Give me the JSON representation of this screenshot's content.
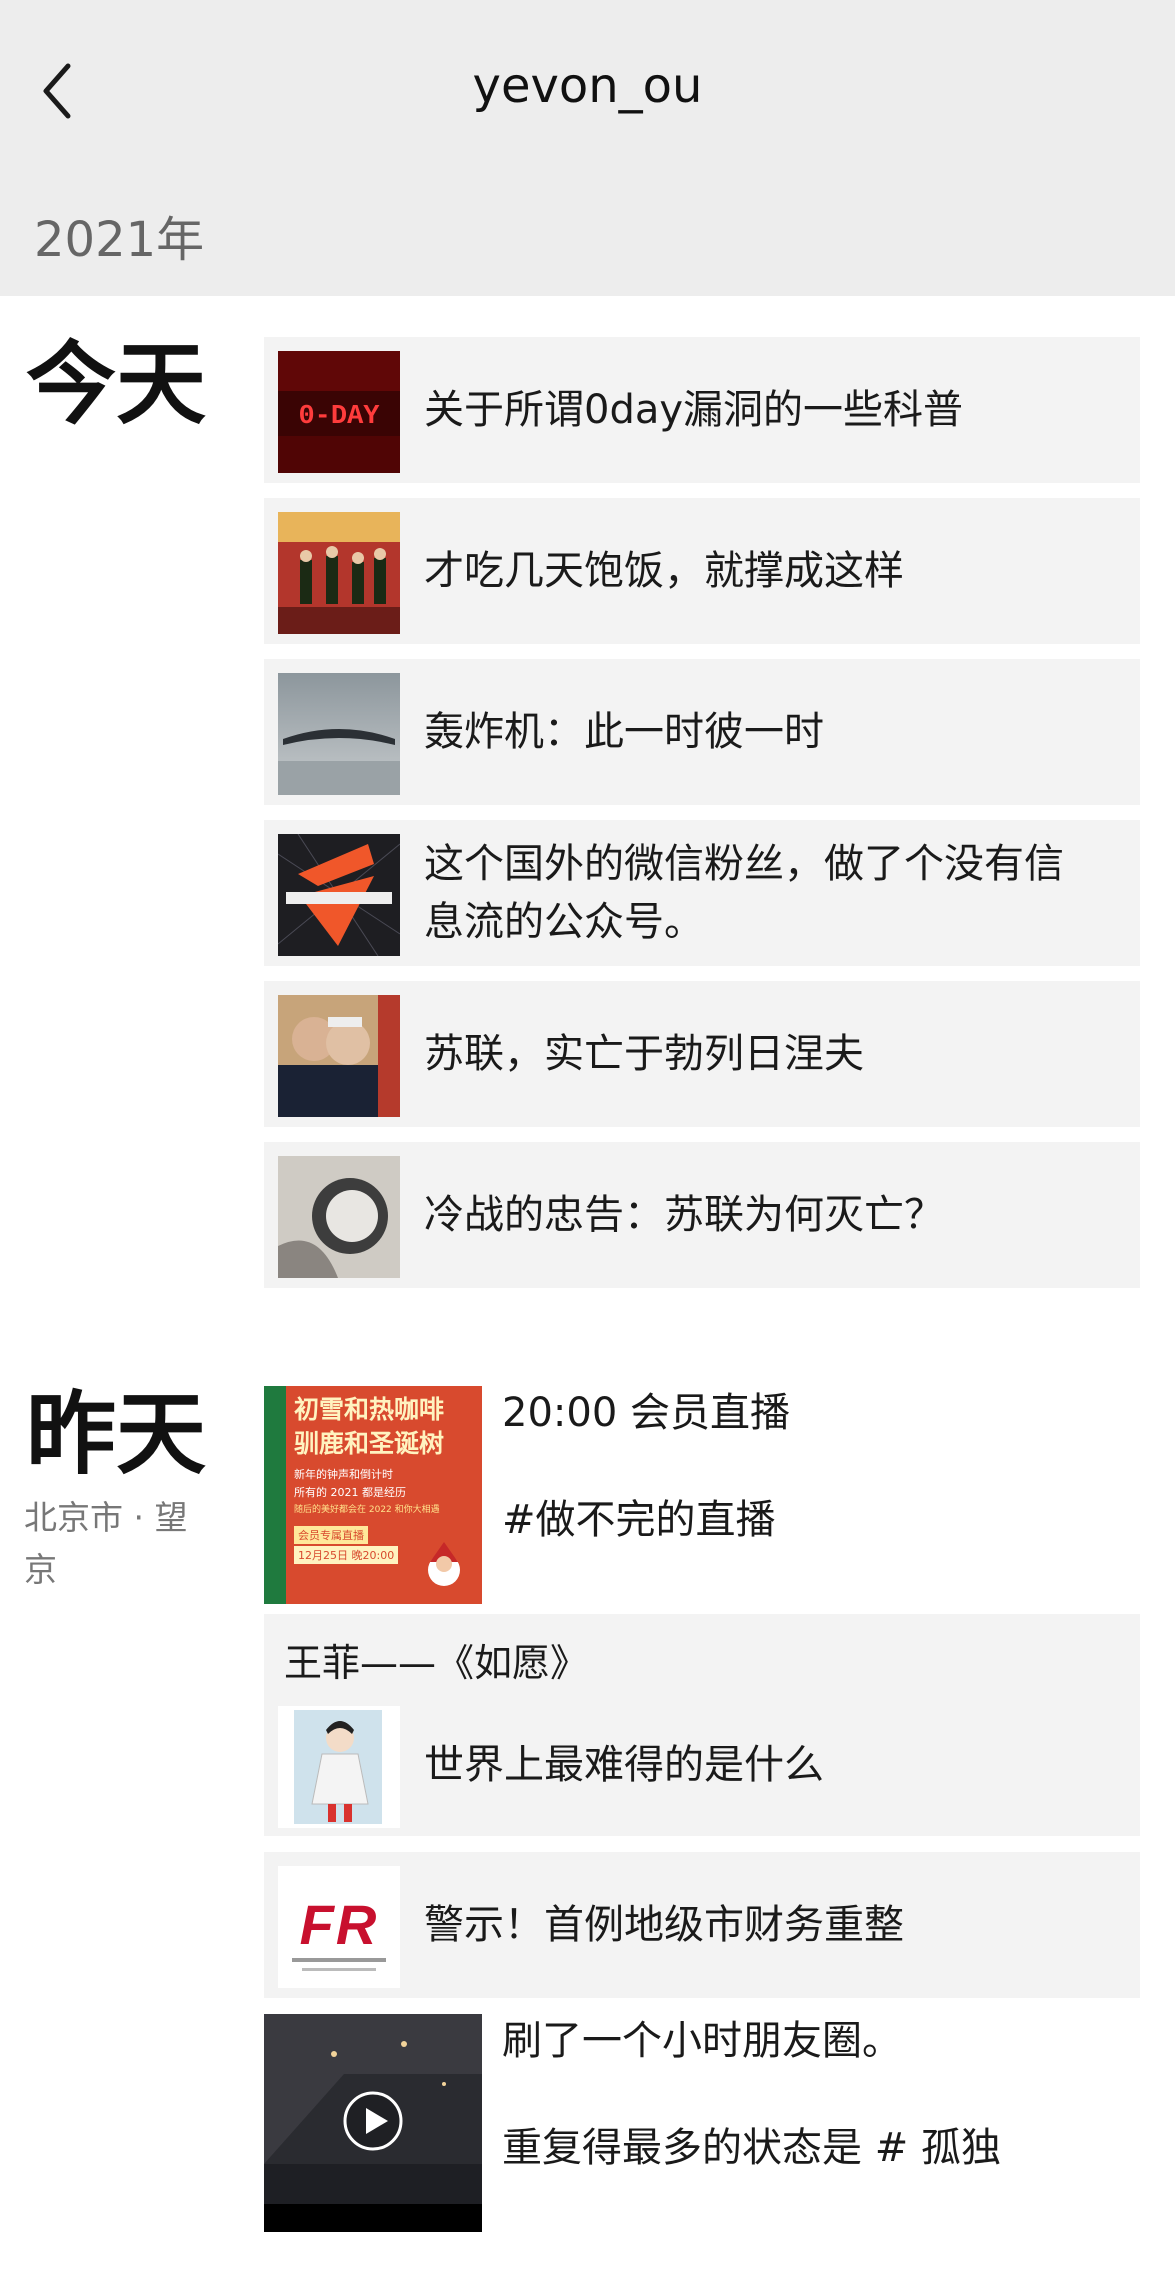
{
  "header": {
    "title": "yevon_ou",
    "year": "2021年"
  },
  "sections": [
    {
      "day": "今天",
      "items": [
        {
          "title": "关于所谓0day漏洞的一些科普",
          "thumb_text": "0-DAY"
        },
        {
          "title": "才吃几天饱饭，就撑成这样"
        },
        {
          "title": "轰炸机：此一时彼一时"
        },
        {
          "title": "这个国外的微信粉丝，做了个没有信息流的公众号。"
        },
        {
          "title": "苏联，实亡于勃列日涅夫"
        },
        {
          "title": "冷战的忠告：苏联为何灭亡？"
        }
      ]
    },
    {
      "day": "昨天",
      "location": "北京市 · 望京",
      "posts": [
        {
          "line1": "20:00 会员直播",
          "line2": "#做不完的直播",
          "poster": {
            "headline1": "初雪和热咖啡",
            "headline2": "驯鹿和圣诞树",
            "sub1": "新年的钟声和倒计时",
            "sub2": "所有的 2021 都是经历",
            "sub3": "随后的美好都会在 2022 和你大相遇",
            "badge": "会员专属直播",
            "date": "12月25日 晚20:00"
          }
        },
        {
          "music_title": "王菲——《如愿》",
          "article": "世界上最难得的是什么"
        },
        {
          "article": "警示！首例地级市财务重整",
          "logo_text": "FR"
        },
        {
          "line1": "刷了一个小时朋友圈。",
          "line2": "重复得最多的状态是 # 孤独"
        }
      ]
    }
  ]
}
